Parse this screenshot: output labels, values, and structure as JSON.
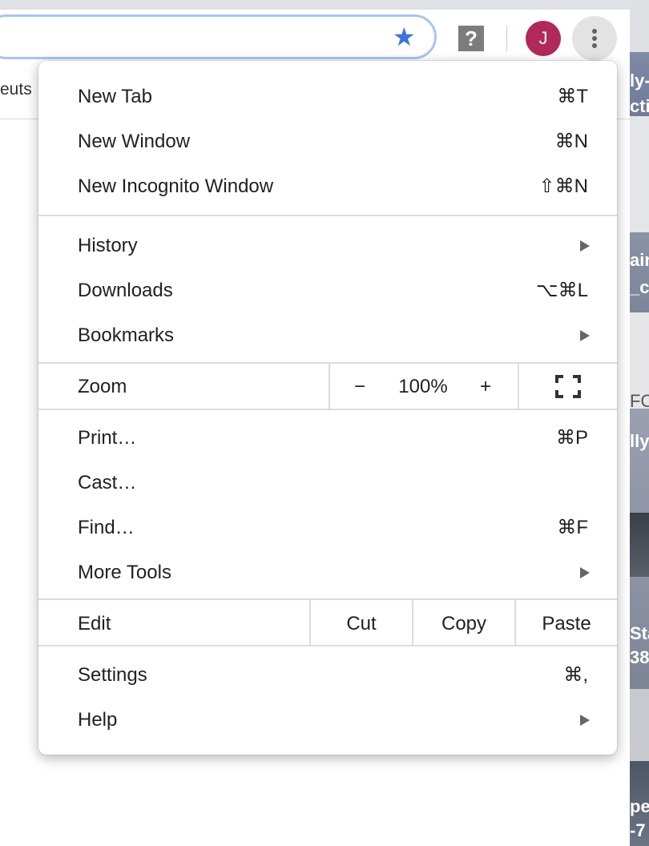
{
  "toolbar": {
    "help_label": "?",
    "avatar_initial": "J",
    "bookmark_fragment": "euts"
  },
  "desktop_fragments": [
    "ly-",
    "cti",
    "ain",
    "_c",
    "FO",
    "lly",
    "Sta",
    "38",
    "pe",
    "-7"
  ],
  "menu": {
    "group1": [
      {
        "label": "New Tab",
        "shortcut": "⌘T"
      },
      {
        "label": "New Window",
        "shortcut": "⌘N"
      },
      {
        "label": "New Incognito Window",
        "shortcut": "⇧⌘N"
      }
    ],
    "group2": [
      {
        "label": "History",
        "shortcut": ""
      },
      {
        "label": "Downloads",
        "shortcut": "⌥⌘L"
      },
      {
        "label": "Bookmarks",
        "shortcut": ""
      }
    ],
    "zoom": {
      "label": "Zoom",
      "minus": "−",
      "value": "100%",
      "plus": "+"
    },
    "group3": [
      {
        "label": "Print…",
        "shortcut": "⌘P"
      },
      {
        "label": "Cast…",
        "shortcut": ""
      },
      {
        "label": "Find…",
        "shortcut": "⌘F"
      },
      {
        "label": "More Tools",
        "shortcut": ""
      }
    ],
    "edit": {
      "label": "Edit",
      "cut": "Cut",
      "copy": "Copy",
      "paste": "Paste"
    },
    "group4": [
      {
        "label": "Settings",
        "shortcut": "⌘,"
      },
      {
        "label": "Help",
        "shortcut": ""
      }
    ]
  },
  "colors": {
    "star": "#3a74e0",
    "avatar": "#b0295a",
    "omnibox_focus": "#a8c4f5"
  }
}
